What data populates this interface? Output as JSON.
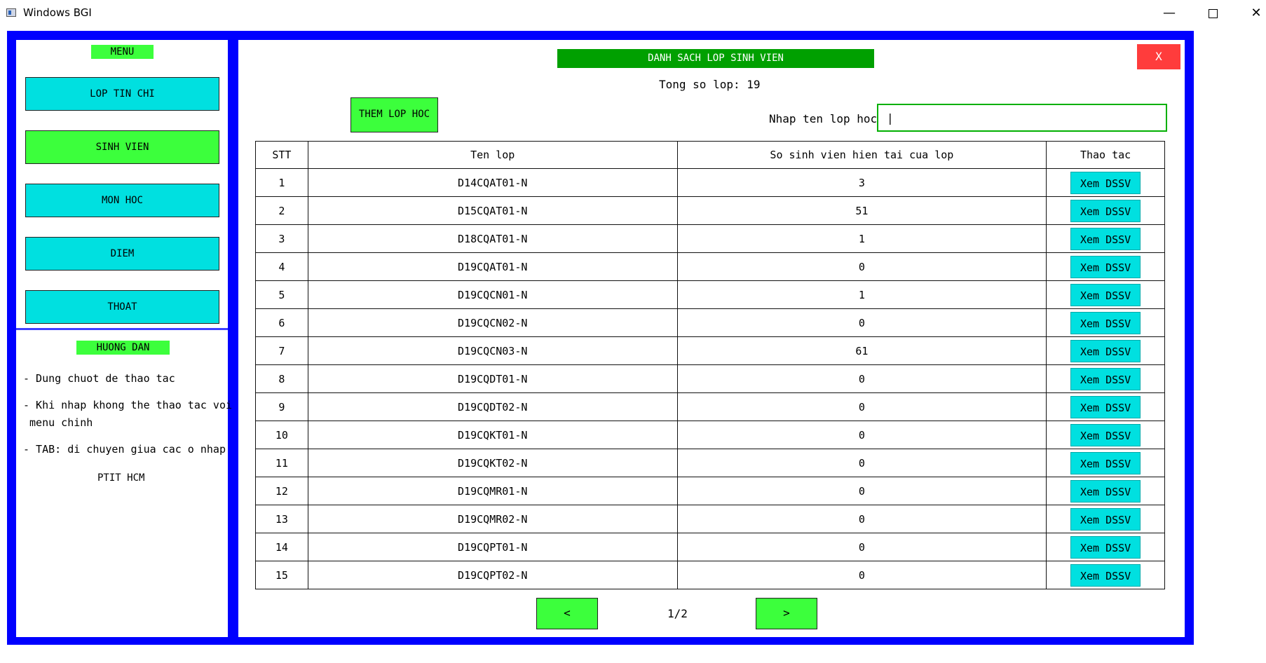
{
  "window": {
    "title": "Windows BGI",
    "minimize_glyph": "—",
    "close_glyph": "✕"
  },
  "menu": {
    "title": "MENU",
    "items": [
      {
        "label": "LOP TIN CHI"
      },
      {
        "label": "SINH VIEN",
        "active": true
      },
      {
        "label": "MON HOC"
      },
      {
        "label": "DIEM"
      },
      {
        "label": "THOAT"
      }
    ]
  },
  "guide": {
    "title": "HUONG DAN",
    "lines": [
      "- Dung chuot de thao tac",
      "- Khi nhap khong the thao tac voi",
      " menu chinh",
      "- TAB: di chuyen giua cac o nhap"
    ],
    "footer": "PTIT HCM"
  },
  "main": {
    "header": "DANH SACH LOP SINH VIEN",
    "close_label": "X",
    "total_text": "Tong so lop: 19",
    "add_button": "THEM LOP HOC",
    "search_label": "Nhap ten lop hoc:",
    "search_value": "|"
  },
  "table": {
    "columns": [
      "STT",
      "Ten lop",
      "So sinh vien hien tai cua lop",
      "Thao tac"
    ],
    "action_label": "Xem DSSV",
    "rows": [
      {
        "stt": "1",
        "name": "D14CQAT01-N",
        "count": "3"
      },
      {
        "stt": "2",
        "name": "D15CQAT01-N",
        "count": "51"
      },
      {
        "stt": "3",
        "name": "D18CQAT01-N",
        "count": "1"
      },
      {
        "stt": "4",
        "name": "D19CQAT01-N",
        "count": "0"
      },
      {
        "stt": "5",
        "name": "D19CQCN01-N",
        "count": "1"
      },
      {
        "stt": "6",
        "name": "D19CQCN02-N",
        "count": "0"
      },
      {
        "stt": "7",
        "name": "D19CQCN03-N",
        "count": "61"
      },
      {
        "stt": "8",
        "name": "D19CQDT01-N",
        "count": "0"
      },
      {
        "stt": "9",
        "name": "D19CQDT02-N",
        "count": "0"
      },
      {
        "stt": "10",
        "name": "D19CQKT01-N",
        "count": "0"
      },
      {
        "stt": "11",
        "name": "D19CQKT02-N",
        "count": "0"
      },
      {
        "stt": "12",
        "name": "D19CQMR01-N",
        "count": "0"
      },
      {
        "stt": "13",
        "name": "D19CQMR02-N",
        "count": "0"
      },
      {
        "stt": "14",
        "name": "D19CQPT01-N",
        "count": "0"
      },
      {
        "stt": "15",
        "name": "D19CQPT02-N",
        "count": "0"
      }
    ]
  },
  "pagination": {
    "prev": "<",
    "next": ">",
    "page": "1/2"
  },
  "colors": {
    "frame": "#0000ff",
    "green": "#3cff3c",
    "cyan": "#00e0e0",
    "header_green": "#00a000",
    "close_red": "#ff3c3c"
  }
}
